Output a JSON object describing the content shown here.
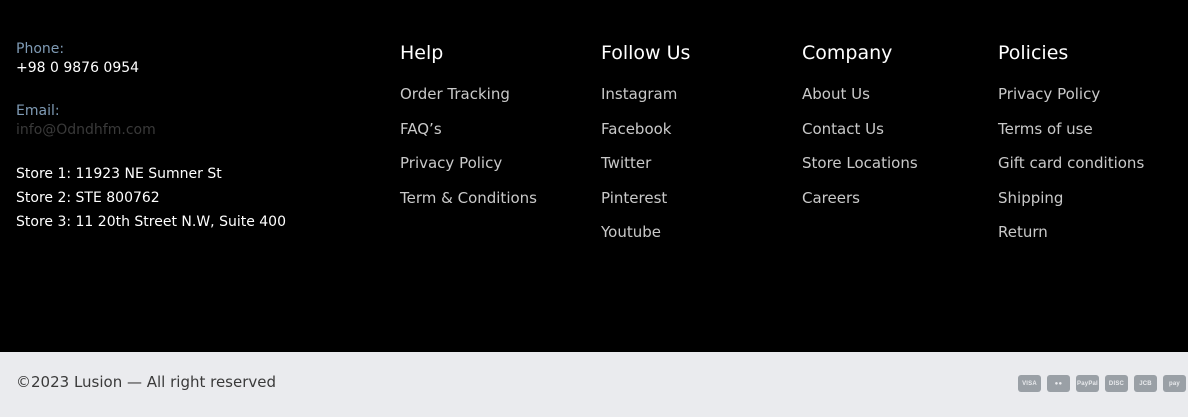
{
  "contact": {
    "phone_label": "Phone:",
    "phone_value": "+98 0 9876 0954",
    "email_label": "Email:",
    "email_value": "info@Odndhfm.com",
    "stores": [
      "Store 1: 11923 NE Sumner St",
      "Store 2: STE 800762",
      "Store 3: 11 20th Street N.W, Suite 400"
    ]
  },
  "columns": [
    {
      "title": "Help",
      "links": [
        "Order Tracking",
        "FAQ’s",
        "Privacy Policy",
        "Term & Conditions"
      ]
    },
    {
      "title": "Follow Us",
      "links": [
        "Instagram",
        "Facebook",
        "Twitter",
        "Pinterest",
        "Youtube"
      ]
    },
    {
      "title": "Company",
      "links": [
        "About Us",
        "Contact Us",
        "Store Locations",
        "Careers"
      ]
    },
    {
      "title": "Policies",
      "links": [
        "Privacy Policy",
        "Terms of use",
        "Gift card conditions",
        "Shipping",
        "Return"
      ]
    }
  ],
  "bottom": {
    "copyright": "©2023 Lusion — All right reserved",
    "payment_icons": [
      {
        "name": "visa-icon",
        "label": "VISA"
      },
      {
        "name": "mastercard-icon",
        "label": "●●"
      },
      {
        "name": "paypal-icon",
        "label": "PayPal"
      },
      {
        "name": "discover-icon",
        "label": "DISC"
      },
      {
        "name": "jcb-icon",
        "label": "JCB"
      },
      {
        "name": "pay-icon",
        "label": "pay"
      }
    ]
  },
  "colors": {
    "background": "#000000",
    "bottom_bar": "#eaebee",
    "label_blue": "#7f9bb5",
    "link_gray": "#c9c9c9"
  }
}
